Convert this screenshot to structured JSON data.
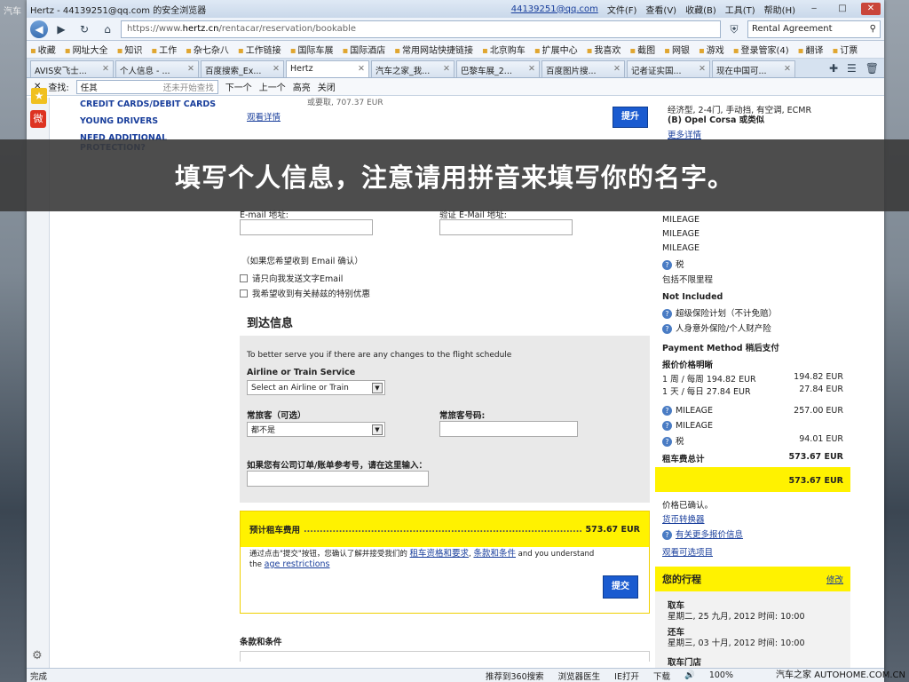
{
  "bg_text": "汽车",
  "window": {
    "title": "Hertz - 44139251@qq.com 的安全浏览器",
    "account": "44139251@qq.com",
    "menu": [
      "文件(F)",
      "查看(V)",
      "收藏(B)",
      "工具(T)",
      "帮助(H)"
    ]
  },
  "nav": {
    "url_prefix": "https://www.",
    "url_domain": "hertz.cn",
    "url_path": "/rentacar/reservation/bookable",
    "search_value": "Rental Agreement"
  },
  "bookmarks": [
    "收藏",
    "网址大全",
    "知识",
    "工作",
    "杂七杂八",
    "工作链接",
    "国际车展",
    "国际酒店",
    "常用网站快捷链接",
    "北京购车",
    "扩展中心",
    "我喜欢",
    "截图",
    "网银",
    "游戏",
    "登录管家(4)",
    "翻译",
    "订票"
  ],
  "tabs": [
    "AVIS安飞士...",
    "个人信息 - ...",
    "百度搜索_Ex...",
    "Hertz",
    "汽车之家_我...",
    "巴黎车展_2...",
    "百度图片搜...",
    "记者证实国...",
    "现在中国可..."
  ],
  "find": {
    "label": "查找:",
    "value": "任其",
    "hint": "还未开始查找",
    "next": "下一个",
    "prev": "上一个",
    "highlight": "高亮",
    "close": "关闭"
  },
  "left_links": [
    "CREDIT CARDS/DEBIT CARDS",
    "YOUNG DRIVERS",
    "NEED ADDITIONAL PROTECTION?"
  ],
  "top_section": {
    "price_text": "或要取, 707.37 EUR",
    "details_link": "观看详情",
    "button": "提升"
  },
  "banner": "填写个人信息，注意请用拼音来填写你的名字。",
  "form": {
    "email_label": "E-mail 地址:",
    "email_confirm_label": "验证 E-Mail 地址:",
    "confirm_note": "（如果您希望收到 Email 确认）",
    "cb1": "请只向我发送文字Email",
    "cb2": "我希望收到有关赫兹的特别优惠"
  },
  "arrival": {
    "title": "到达信息",
    "note": "To better serve you if there are any changes to the flight schedule",
    "airline_label": "Airline or Train Service",
    "airline_select": "Select an Airline or Train",
    "ff_label": "常旅客（可选）",
    "ff_select": "都不是",
    "ff_no_label": "常旅客号码:",
    "corp_label": "如果您有公司订单/账单参考号，请在这里输入："
  },
  "estimate": {
    "label": "预计租车费用",
    "amount": "573.67 EUR",
    "agree_pre": "通过点击\"提交\"按钮，您确认了解并接受我们的",
    "agree_link1": "租车资格和要求",
    "agree_link2": "条款和条件",
    "agree_mid": "and you understand the",
    "agree_link3": "age restrictions",
    "submit": "提交"
  },
  "terms_title": "条款和条件",
  "right": {
    "car_desc": "经济型, 2-4门, 手动挡, 有空调, ECMR",
    "car_model": "(B) Opel Corsa 或类似",
    "more_details": "更多详情",
    "mileage": [
      "MILEAGE",
      "MILEAGE",
      "MILEAGE"
    ],
    "tax": "税",
    "unlimited": "包括不限里程",
    "not_included": "Not Included",
    "ni1": "超级保险计划（不计免赔）",
    "ni2": "人身意外保险/个人财产险",
    "payment": "Payment Method 稍后支付",
    "price_title": "报价价格明晰",
    "week_label": "1 周 / 每周 194.82 EUR",
    "week_val": "194.82 EUR",
    "day_label": "1 天 / 每日 27.84 EUR",
    "day_val": "27.84 EUR",
    "m1_label": "MILEAGE",
    "m1_val": "257.00 EUR",
    "m2_label": "MILEAGE",
    "tax_label": "税",
    "tax_val": "94.01 EUR",
    "total_label": "租车费总计",
    "total_val": "573.67 EUR",
    "total_bar": "573.67 EUR",
    "confirmed": "价格已确认。",
    "converter": "货币转换器",
    "more_quote": "有关更多报价信息",
    "options": "观看可选项目",
    "trip_title": "您的行程",
    "edit": "修改",
    "pick_label": "取车",
    "pick_val": "星期二, 25 九月, 2012 时间: 10:00",
    "ret_label": "还车",
    "ret_val": "星期三, 03 十月, 2012 时间: 10:00",
    "store_label": "取车门店"
  },
  "status": {
    "done": "完成",
    "s1": "推荐到360搜索",
    "s2": "浏览器医生",
    "s3": "IE打开",
    "s4": "下载",
    "zoom": "100%"
  },
  "watermark": "汽车之家 AUTOHOME.COM.CN"
}
